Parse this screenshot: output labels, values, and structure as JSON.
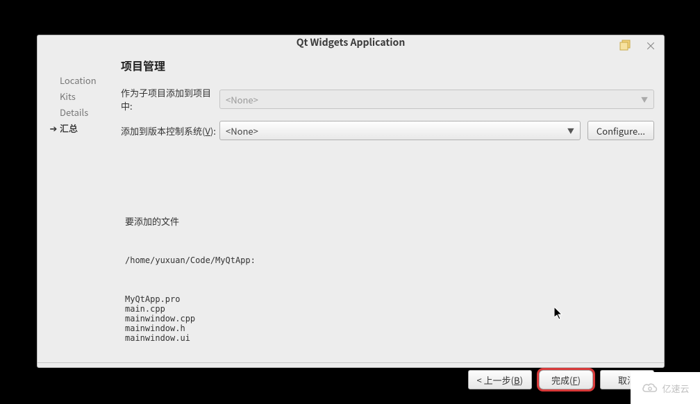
{
  "title": "Qt Widgets Application",
  "sidebar": {
    "items": [
      {
        "label": "Location",
        "active": false
      },
      {
        "label": "Kits",
        "active": false
      },
      {
        "label": "Details",
        "active": false
      },
      {
        "label": "汇总",
        "active": true
      }
    ]
  },
  "page": {
    "heading": "项目管理",
    "subproject_label": "作为子项目添加到项目中:",
    "subproject_value": "<None>",
    "vcs_label_pre": "添加到版本控制系统(",
    "vcs_label_key": "V",
    "vcs_label_post": "):",
    "vcs_value": "<None>",
    "configure_label": "Configure...",
    "files_heading": "要添加的文件",
    "files_path": "/home/yuxuan/Code/MyQtApp:",
    "files_list": "MyQtApp.pro\nmain.cpp\nmainwindow.cpp\nmainwindow.h\nmainwindow.ui"
  },
  "footer": {
    "back_pre": "< 上一步(",
    "back_key": "B",
    "back_post": ")",
    "finish_pre": "完成(",
    "finish_key": "F",
    "finish_post": ")",
    "cancel": "取消"
  },
  "watermark": "亿速云"
}
